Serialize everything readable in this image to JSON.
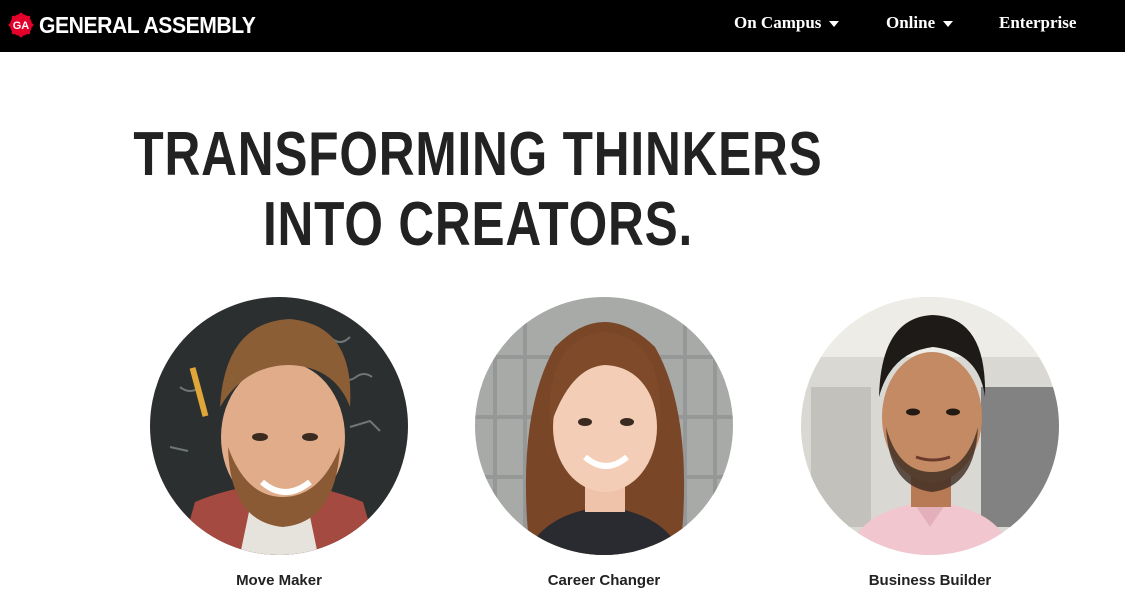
{
  "brand": {
    "badge_text": "GA",
    "name": "GENERAL ASSEMBLY",
    "badge_color": "#e4002b"
  },
  "nav": {
    "items": [
      {
        "label": "On Campus",
        "has_dropdown": true
      },
      {
        "label": "Online",
        "has_dropdown": true
      },
      {
        "label": "Enterprise",
        "has_dropdown": false
      }
    ]
  },
  "hero": {
    "line1": "TRANSFORMING THINKERS",
    "line2": "INTO CREATORS."
  },
  "personas": [
    {
      "label": "Move Maker"
    },
    {
      "label": "Career Changer"
    },
    {
      "label": "Business Builder"
    }
  ],
  "colors": {
    "navbar_bg": "#000000",
    "text": "#222222",
    "page_bg": "#ffffff"
  }
}
